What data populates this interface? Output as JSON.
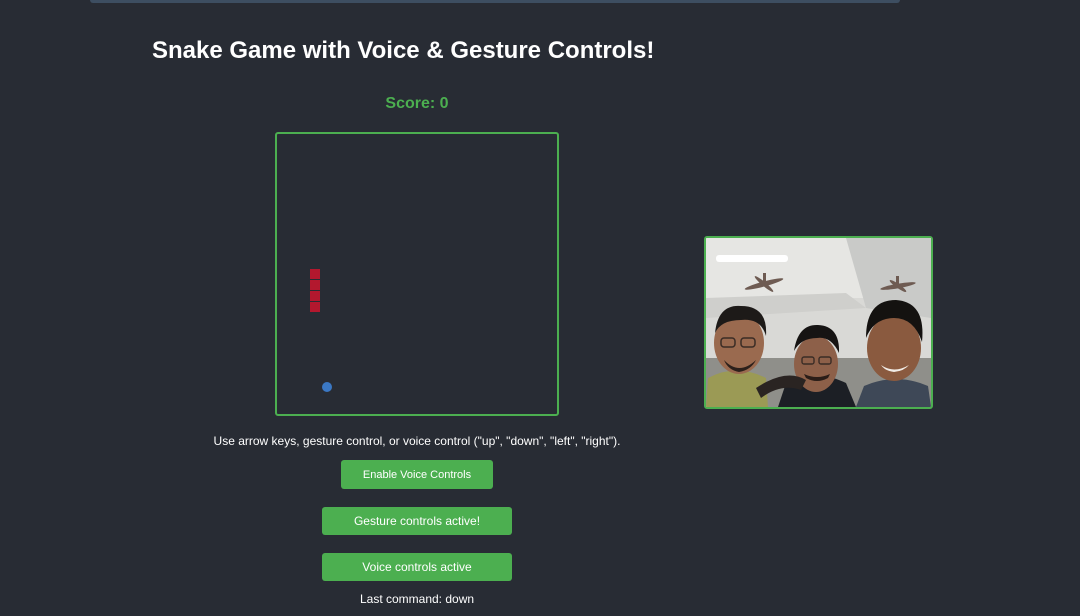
{
  "header": {
    "title": "Snake Game with Voice & Gesture Controls!"
  },
  "game": {
    "score_text": "Score: 0",
    "snake_color": "#b3182e",
    "food_color": "#3b78c4",
    "board_border_color": "#4caf50"
  },
  "instructions": "Use arrow keys, gesture control, or voice control (\"up\", \"down\", \"left\", \"right\").",
  "controls": {
    "enable_voice_label": "Enable Voice Controls",
    "gesture_status": "Gesture controls active!",
    "voice_status": "Voice controls active",
    "last_command": "Last command: down"
  },
  "colors": {
    "background": "#282c34",
    "accent": "#4caf50"
  }
}
